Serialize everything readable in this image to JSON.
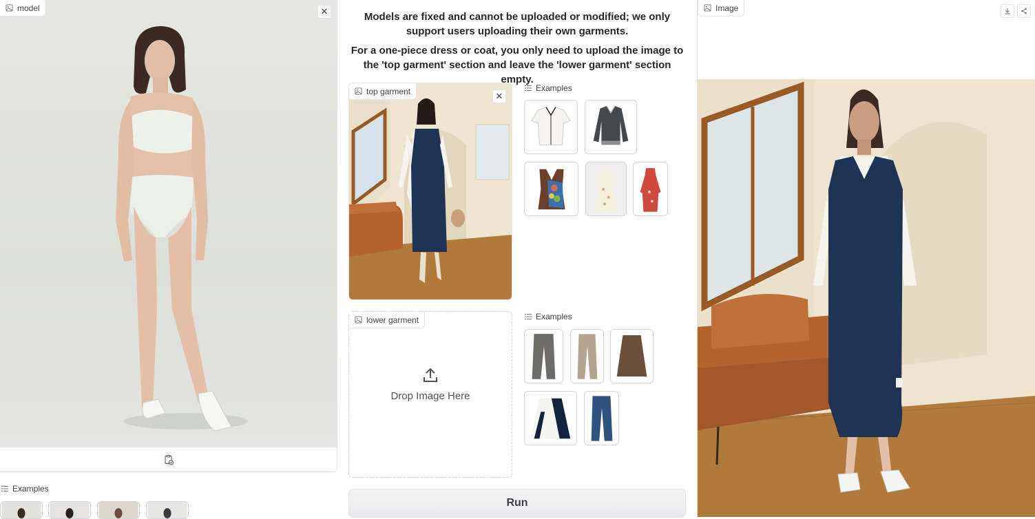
{
  "model_panel": {
    "label": "model",
    "icon": "image-icon",
    "close_icon": "close-icon",
    "footer_icon": "clipboard-icon"
  },
  "model_examples": {
    "label": "Examples",
    "count": 4
  },
  "notice": {
    "line1": "Models are fixed and cannot be uploaded or modified; we only support users uploading their own garments.",
    "line2": "For a one-piece dress or coat, you only need to upload the image to the 'top garment' section and leave the 'lower garment' section empty."
  },
  "top_garment": {
    "label": "top garment",
    "icon": "image-icon"
  },
  "top_examples": {
    "label": "Examples",
    "items": [
      "white blouse",
      "grey polo sweater",
      "floral vest",
      "floral dress",
      "red floral dress"
    ]
  },
  "lower_garment": {
    "label": "lower garment",
    "drop_text": "Drop Image Here",
    "icon": "upload-icon"
  },
  "lower_examples": {
    "label": "Examples",
    "items": [
      "grey trousers",
      "beige trousers",
      "brown skirt",
      "black white skirt",
      "blue jeans"
    ]
  },
  "run_button": {
    "label": "Run"
  },
  "result_panel": {
    "label": "Image",
    "icon": "image-icon",
    "download_icon": "download-icon",
    "share_icon": "share-icon"
  },
  "colors": {
    "sweater_navy": "#1f3452",
    "sofa_orange": "#b4622e",
    "floor_wood": "#b07a3d",
    "wall_cream": "#eee4cf"
  }
}
